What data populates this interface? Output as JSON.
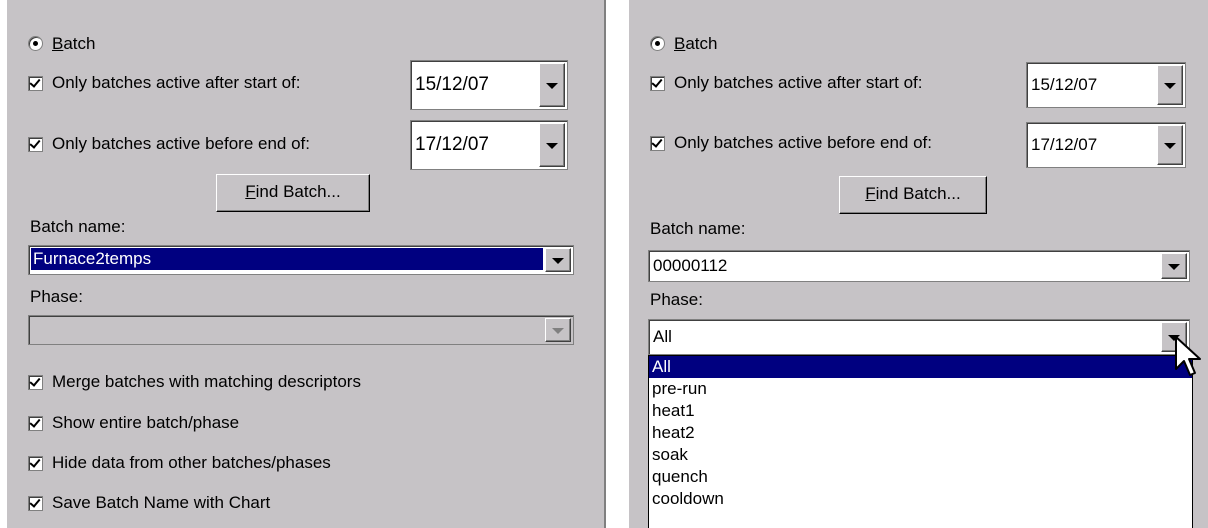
{
  "left": {
    "batch_radio_label": "Batch",
    "only_after_label": "Only batches active after start of:",
    "only_after_date": "15/12/07",
    "only_before_label": "Only batches active before end of:",
    "only_before_date": "17/12/07",
    "find_batch_button": "Find Batch...",
    "batch_name_label": "Batch name:",
    "batch_name_value": "Furnace2temps",
    "phase_label": "Phase:",
    "phase_value": "",
    "merge_label": "Merge batches with matching descriptors",
    "show_entire_label": "Show entire batch/phase",
    "hide_data_label": "Hide data from other batches/phases",
    "save_name_label": "Save Batch Name with Chart"
  },
  "right": {
    "batch_radio_label": "Batch",
    "only_after_label": "Only batches active after start of:",
    "only_after_date": "15/12/07",
    "only_before_label": "Only batches active before end of:",
    "only_before_date": "17/12/07",
    "find_batch_button": "Find Batch...",
    "batch_name_label": "Batch name:",
    "batch_name_value": "00000112",
    "phase_label": "Phase:",
    "phase_value": "All",
    "phase_options": [
      "All",
      "pre-run",
      "heat1",
      "heat2",
      "soak",
      "quench",
      "cooldown"
    ],
    "phase_highlighted": "All"
  },
  "colors": {
    "dialog_bg": "#c6c3c6",
    "selection": "#000080"
  }
}
